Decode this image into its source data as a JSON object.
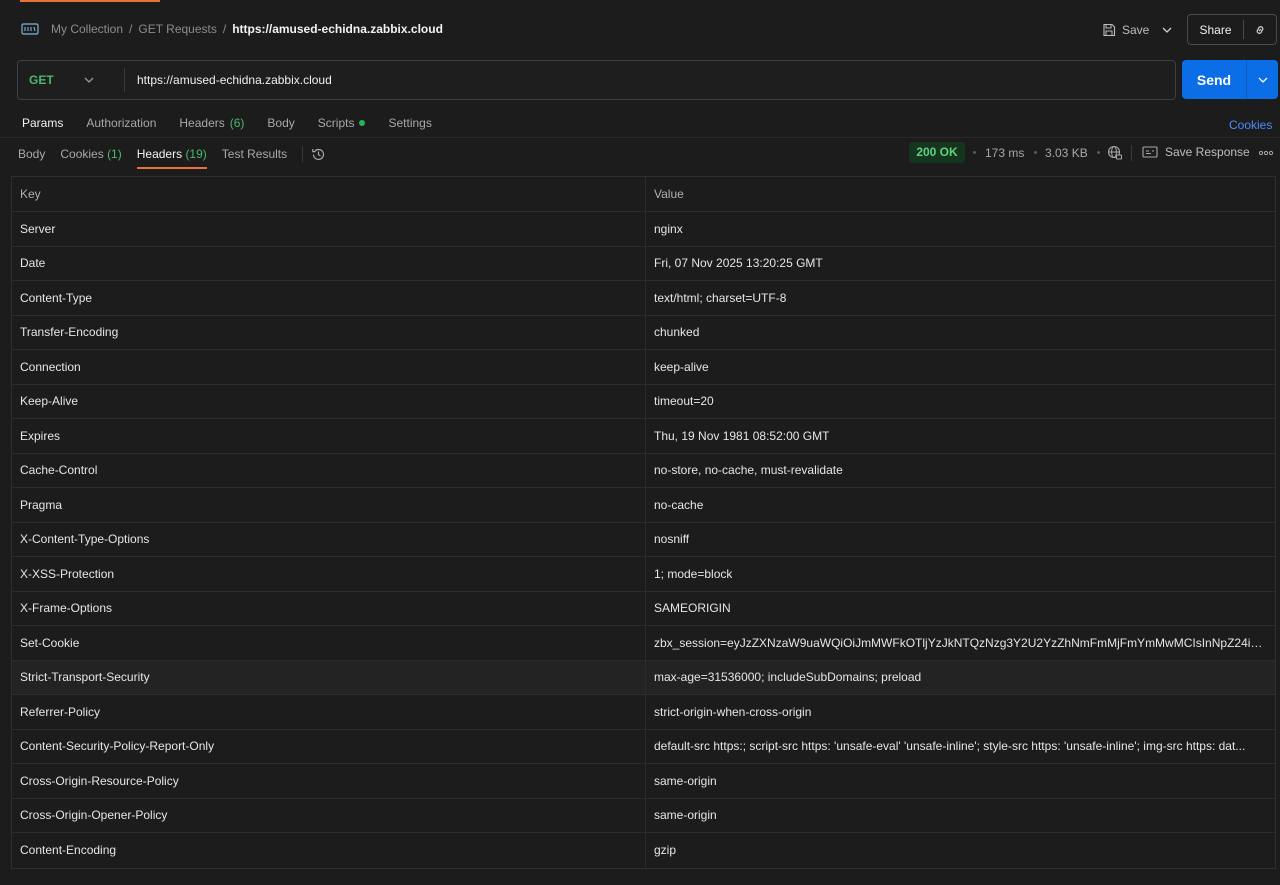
{
  "breadcrumb": {
    "http_icon_label": "HTTP",
    "items": [
      "My Collection",
      "GET Requests"
    ],
    "separator": "/",
    "current": "https://amused-echidna.zabbix.cloud"
  },
  "toolbar": {
    "save_label": "Save",
    "share_label": "Share"
  },
  "request": {
    "method": "GET",
    "url": "https://amused-echidna.zabbix.cloud",
    "send_label": "Send"
  },
  "request_tabs": [
    {
      "label": "Params",
      "count": ""
    },
    {
      "label": "Authorization",
      "count": ""
    },
    {
      "label": "Headers",
      "count": "(6)"
    },
    {
      "label": "Body",
      "count": ""
    },
    {
      "label": "Scripts",
      "count": ""
    },
    {
      "label": "Settings",
      "count": ""
    }
  ],
  "cookies_link": "Cookies",
  "response_tabs": [
    {
      "label": "Body",
      "count": ""
    },
    {
      "label": "Cookies",
      "count": "(1)"
    },
    {
      "label": "Headers",
      "count": "(19)"
    },
    {
      "label": "Test Results",
      "count": ""
    }
  ],
  "response_meta": {
    "status": "200 OK",
    "time": "173 ms",
    "size": "3.03 KB",
    "save_response_label": "Save Response"
  },
  "colors": {
    "accent": "#e8703a",
    "send": "#0b6ee6",
    "ok": "#5fd27d",
    "link": "#4c8dff"
  },
  "table": {
    "columns": [
      "Key",
      "Value"
    ],
    "rows": [
      [
        "Server",
        "nginx"
      ],
      [
        "Date",
        "Fri, 07 Nov 2025 13:20:25 GMT"
      ],
      [
        "Content-Type",
        "text/html; charset=UTF-8"
      ],
      [
        "Transfer-Encoding",
        "chunked"
      ],
      [
        "Connection",
        "keep-alive"
      ],
      [
        "Keep-Alive",
        "timeout=20"
      ],
      [
        "Expires",
        "Thu, 19 Nov 1981 08:52:00 GMT"
      ],
      [
        "Cache-Control",
        "no-store, no-cache, must-revalidate"
      ],
      [
        "Pragma",
        "no-cache"
      ],
      [
        "X-Content-Type-Options",
        "nosniff"
      ],
      [
        "X-XSS-Protection",
        "1; mode=block"
      ],
      [
        "X-Frame-Options",
        "SAMEORIGIN"
      ],
      [
        "Set-Cookie",
        "zbx_session=eyJzZXNzaW9uaWQiOiJmMWFkOTljYzJkNTQzNzg3Y2U2YzZhNmFmMjFmYmMwMCIsInNpZ24iOiJ..."
      ],
      [
        "Strict-Transport-Security",
        "max-age=31536000; includeSubDomains; preload"
      ],
      [
        "Referrer-Policy",
        "strict-origin-when-cross-origin"
      ],
      [
        "Content-Security-Policy-Report-Only",
        "default-src https:; script-src https: 'unsafe-eval' 'unsafe-inline'; style-src https: 'unsafe-inline'; img-src https: dat..."
      ],
      [
        "Cross-Origin-Resource-Policy",
        "same-origin"
      ],
      [
        "Cross-Origin-Opener-Policy",
        "same-origin"
      ],
      [
        "Content-Encoding",
        "gzip"
      ]
    ]
  }
}
